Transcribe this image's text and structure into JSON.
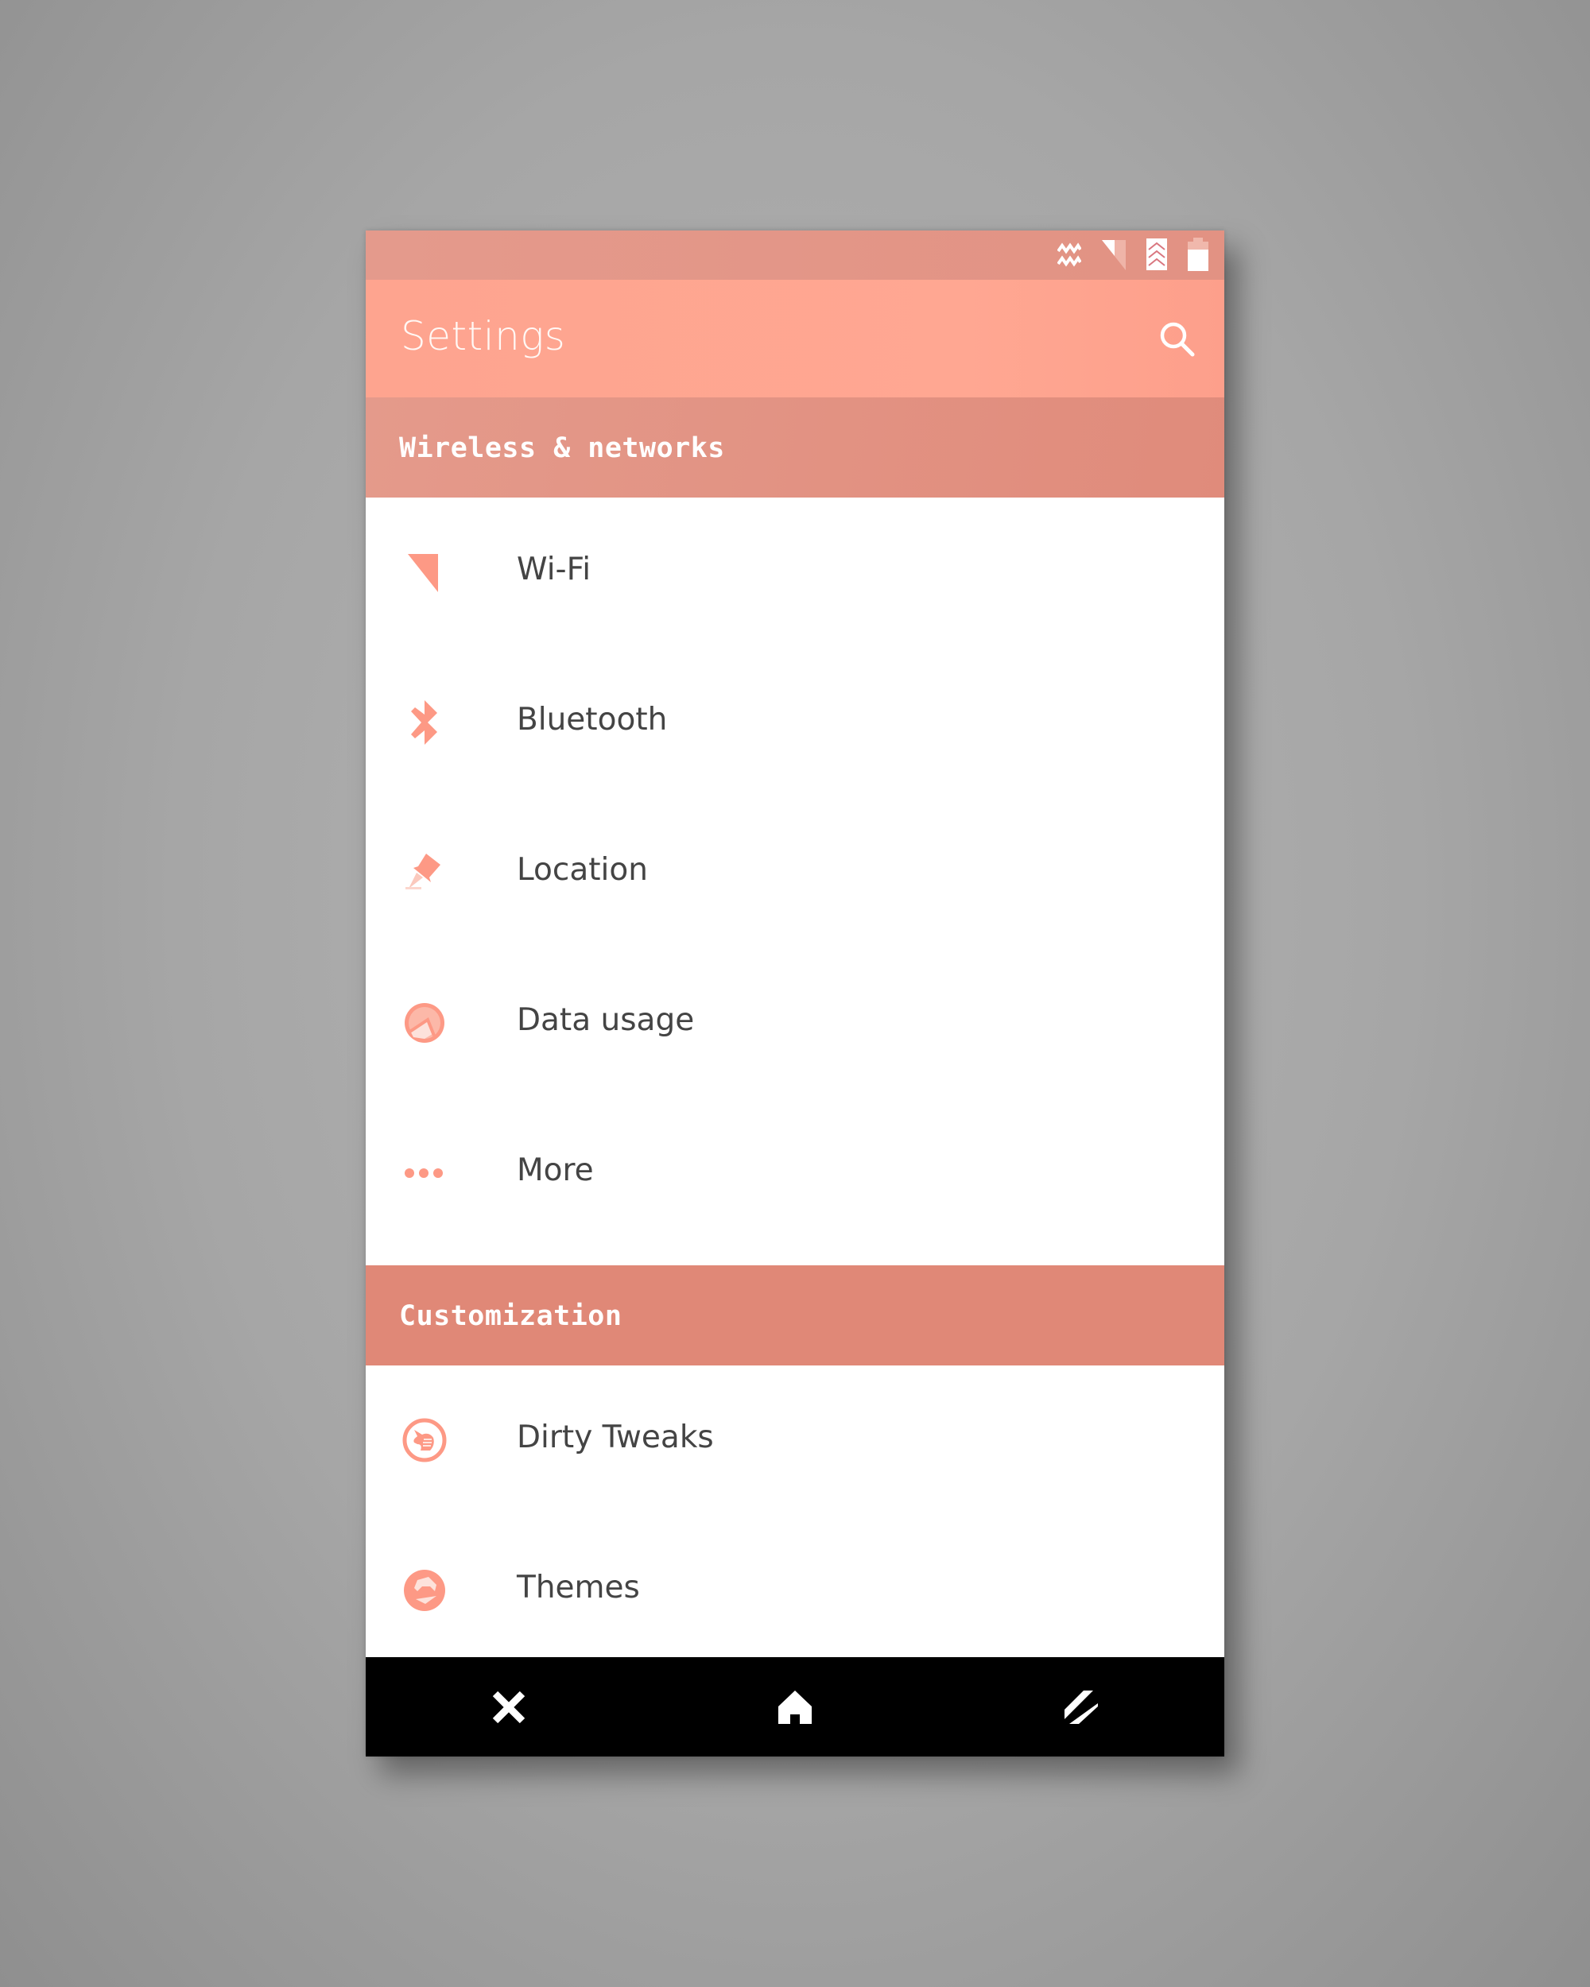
{
  "status_bar": {
    "icons": [
      "signal-wave-icon",
      "cell-signal-icon",
      "data-arrows-icon",
      "battery-icon"
    ]
  },
  "toolbar": {
    "title": "Settings",
    "search_icon": "search-icon"
  },
  "sections": [
    {
      "title": "Wireless & networks",
      "items": [
        {
          "label": "Wi-Fi",
          "icon": "wifi-icon"
        },
        {
          "label": "Bluetooth",
          "icon": "bluetooth-icon"
        },
        {
          "label": "Location",
          "icon": "location-pin-icon"
        },
        {
          "label": "Data usage",
          "icon": "data-usage-icon"
        },
        {
          "label": "More",
          "icon": "more-dots-icon"
        }
      ]
    },
    {
      "title": "Customization",
      "items": [
        {
          "label": "Dirty Tweaks",
          "icon": "unicorn-icon"
        },
        {
          "label": "Themes",
          "icon": "themes-icon"
        }
      ]
    }
  ],
  "nav_bar": {
    "back_icon": "back-x-icon",
    "home_icon": "home-icon",
    "recents_icon": "recents-icon"
  },
  "colors": {
    "accent": "#ffa38e",
    "status_bar": "#e39585",
    "section_header": "#e08877",
    "icon": "#fd9985",
    "text": "#444444",
    "nav_bar": "#000000"
  }
}
